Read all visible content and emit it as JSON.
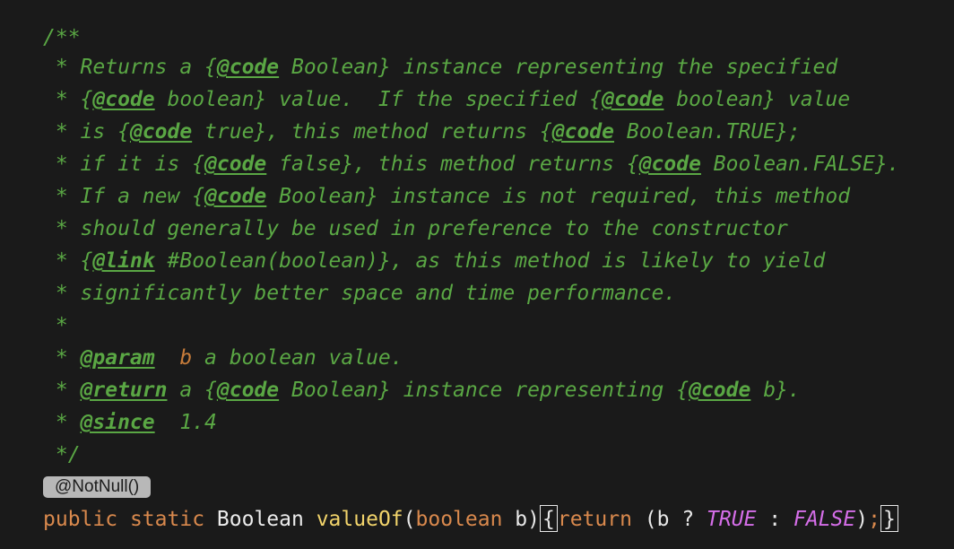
{
  "doc": {
    "open": "/**",
    "star": " * ",
    "close": " */",
    "lines": [
      {
        "t1": "Returns a {",
        "tag1": "@code",
        "t2": " Boolean} instance representing the specified"
      },
      {
        "t1": "{",
        "tag1": "@code",
        "t2": " boolean} value.  If the specified {",
        "tag2": "@code",
        "t3": " boolean} value"
      },
      {
        "t1": "is {",
        "tag1": "@code",
        "t2": " true}, this method returns {",
        "tag2": "@code",
        "t3": " Boolean.TRUE};"
      },
      {
        "t1": "if it is {",
        "tag1": "@code",
        "t2": " false}, this method returns {",
        "tag2": "@code",
        "t3": " Boolean.FALSE}."
      },
      {
        "t1": "If a new {",
        "tag1": "@code",
        "t2": " Boolean} instance is not required, this method"
      },
      {
        "t1": "should generally be used in preference to the constructor"
      },
      {
        "t1": "{",
        "tag1": "@link",
        "t2": " #Boolean(boolean)}, as this method is likely to yield"
      },
      {
        "t1": "significantly better space and time performance."
      },
      {
        "t1": ""
      }
    ],
    "param": {
      "tag": "@param",
      "name": "b",
      "desc": " a boolean value."
    },
    "ret": {
      "tag": "@return",
      "t1": " a {",
      "tag2": "@code",
      "t2": " Boolean} instance representing {",
      "tag3": "@code",
      "t3": " b}."
    },
    "since": {
      "tag": "@since",
      "value": "  1.4"
    }
  },
  "annotation": {
    "label": "@NotNull()"
  },
  "code": {
    "kw_public": "public",
    "kw_static": "static",
    "type": "Boolean",
    "method": "valueOf",
    "paren_open": "(",
    "param_type": "boolean",
    "param_name": " b)",
    "brace_open": "{",
    "kw_return": "return",
    "expr_open": " (b ? ",
    "const_true": "TRUE",
    "colon": " : ",
    "const_false": "FALSE",
    "expr_close": ")",
    "semicolon": ";",
    "brace_close": "}"
  },
  "colors": {
    "background": "#1a1a1a",
    "doc_comment": "#5aa744",
    "keyword": "#d9894d",
    "method": "#f2d46b",
    "constant": "#d56ee8",
    "param_name": "#c77c3a"
  }
}
